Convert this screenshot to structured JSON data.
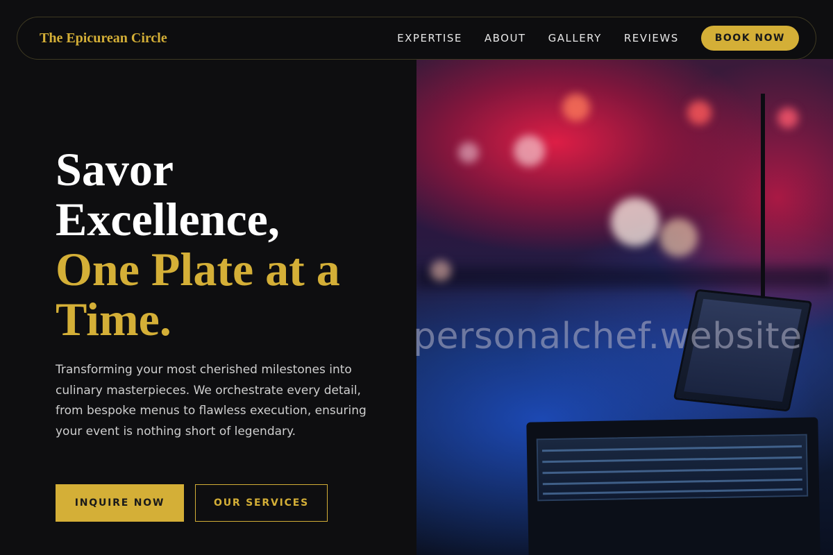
{
  "brand": {
    "name": "The Epicurean Circle",
    "accent_color": "#d4af37"
  },
  "nav": {
    "links": [
      "EXPERTISE",
      "ABOUT",
      "GALLERY",
      "REVIEWS"
    ],
    "cta_label": "BOOK NOW"
  },
  "hero": {
    "title_line1": "Savor",
    "title_line2": "Excellence,",
    "title_gold_line1": "One Plate at a",
    "title_gold_line2": "Time.",
    "description": "Transforming your most cherished milestones into culinary masterpieces. We orchestrate every detail, from bespoke menus to flawless execution, ensuring your event is nothing short of legendary.",
    "primary_button": "INQUIRE NOW",
    "secondary_button": "OUR SERVICES",
    "watermark": "personalchef.website"
  }
}
